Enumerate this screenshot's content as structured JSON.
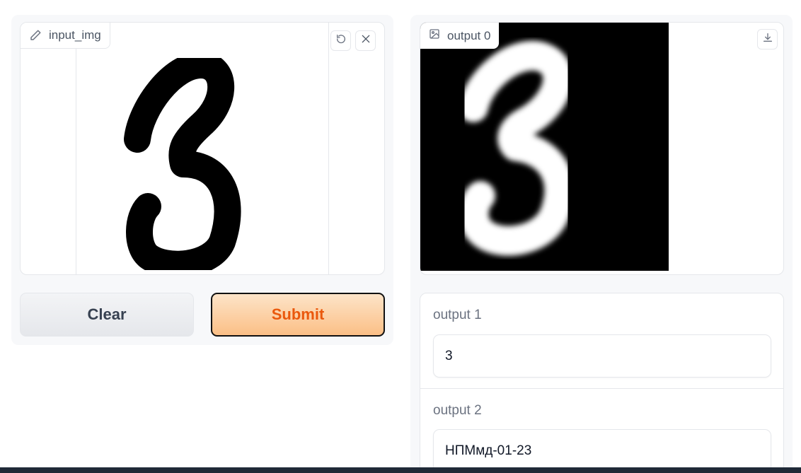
{
  "input": {
    "label": "input_img",
    "digit": "3",
    "icons": [
      "pencil-icon",
      "undo-icon",
      "close-icon"
    ]
  },
  "buttons": {
    "clear_label": "Clear",
    "submit_label": "Submit"
  },
  "outputs": {
    "image_label": "output 0",
    "image_digit": "3",
    "output1_label": "output 1",
    "output1_value": "3",
    "output2_label": "output 2",
    "output2_value": "НПМмд-01-23"
  },
  "colors": {
    "accent": "#ea580c",
    "submit_bg": "#fbbf86",
    "border": "#e5e7eb"
  }
}
